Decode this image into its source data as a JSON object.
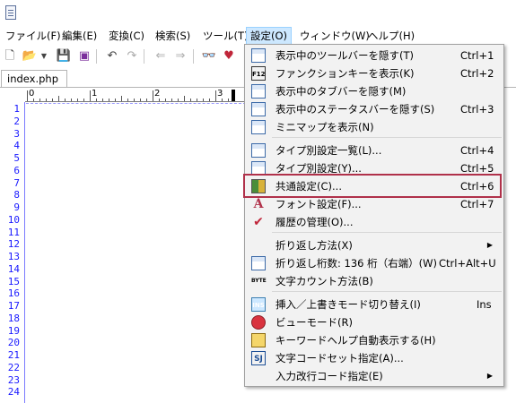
{
  "menubar": {
    "items": [
      {
        "label": "ファイル(F)"
      },
      {
        "label": "編集(E)"
      },
      {
        "label": "変換(C)"
      },
      {
        "label": "検索(S)"
      },
      {
        "label": "ツール(T)"
      },
      {
        "label": "設定(O)"
      },
      {
        "label": "ウィンドウ(W)"
      },
      {
        "label": "ヘルプ(H)"
      }
    ]
  },
  "tab": {
    "label": "index.php"
  },
  "ruler": {
    "labels": [
      "0",
      "1",
      "2",
      "3"
    ]
  },
  "line_numbers": [
    "1",
    "2",
    "3",
    "4",
    "5",
    "6",
    "7",
    "8",
    "9",
    "10",
    "11",
    "12",
    "13",
    "14",
    "15",
    "16",
    "17",
    "18",
    "19",
    "20",
    "21",
    "22",
    "23",
    "24"
  ],
  "dropdown": {
    "items": [
      {
        "icon": "toolbar-icon",
        "label": "表示中のツールバーを隠す(T)",
        "shortcut": "Ctrl+1"
      },
      {
        "icon": "function-keys-icon",
        "icon_text": "F12",
        "label": "ファンクションキーを表示(K)",
        "shortcut": "Ctrl+2"
      },
      {
        "icon": "tabbar-icon",
        "label": "表示中のタブバーを隠す(M)",
        "shortcut": ""
      },
      {
        "icon": "statusbar-icon",
        "label": "表示中のステータスバーを隠す(S)",
        "shortcut": "Ctrl+3"
      },
      {
        "icon": "minimap-icon",
        "label": "ミニマップを表示(N)",
        "shortcut": ""
      },
      {
        "icon": "type-settings-list-icon",
        "label": "タイプ別設定一覧(L)...",
        "shortcut": "Ctrl+4"
      },
      {
        "icon": "type-settings-icon",
        "label": "タイプ別設定(Y)...",
        "shortcut": "Ctrl+5"
      },
      {
        "icon": "common-settings-icon",
        "label": "共通設定(C)...",
        "shortcut": "Ctrl+6"
      },
      {
        "icon": "font-icon",
        "icon_text": "A",
        "label": "フォント設定(F)...",
        "shortcut": "Ctrl+7"
      },
      {
        "icon": "checkmark-icon",
        "icon_text": "✔",
        "label": "履歴の管理(O)...",
        "shortcut": ""
      },
      {
        "icon": "",
        "label": "折り返し方法(X)",
        "shortcut": "",
        "submenu": true
      },
      {
        "icon": "wrap-icon",
        "label": "折り返し桁数: 136 桁（右端）(W)",
        "shortcut": "Ctrl+Alt+U"
      },
      {
        "icon": "byte-icon",
        "icon_text": "BYTE",
        "label": "文字カウント方法(B)",
        "shortcut": ""
      },
      {
        "icon": "insert-mode-icon",
        "icon_text": "INS",
        "label": "挿入／上書きモード切り替え(I)",
        "shortcut": "Ins"
      },
      {
        "icon": "view-mode-icon",
        "label": "ビューモード(R)",
        "shortcut": ""
      },
      {
        "icon": "keyword-help-icon",
        "label": "キーワードヘルプ自動表示する(H)",
        "shortcut": ""
      },
      {
        "icon": "charset-icon",
        "icon_text": "SJ",
        "label": "文字コードセット指定(A)...",
        "shortcut": ""
      },
      {
        "icon": "",
        "label": "入力改行コード指定(E)",
        "shortcut": "",
        "submenu": true
      }
    ]
  },
  "colors": {
    "highlight_border": "#b0314a",
    "menu_active": "#cde8ff",
    "line_number": "#1a1aff"
  }
}
